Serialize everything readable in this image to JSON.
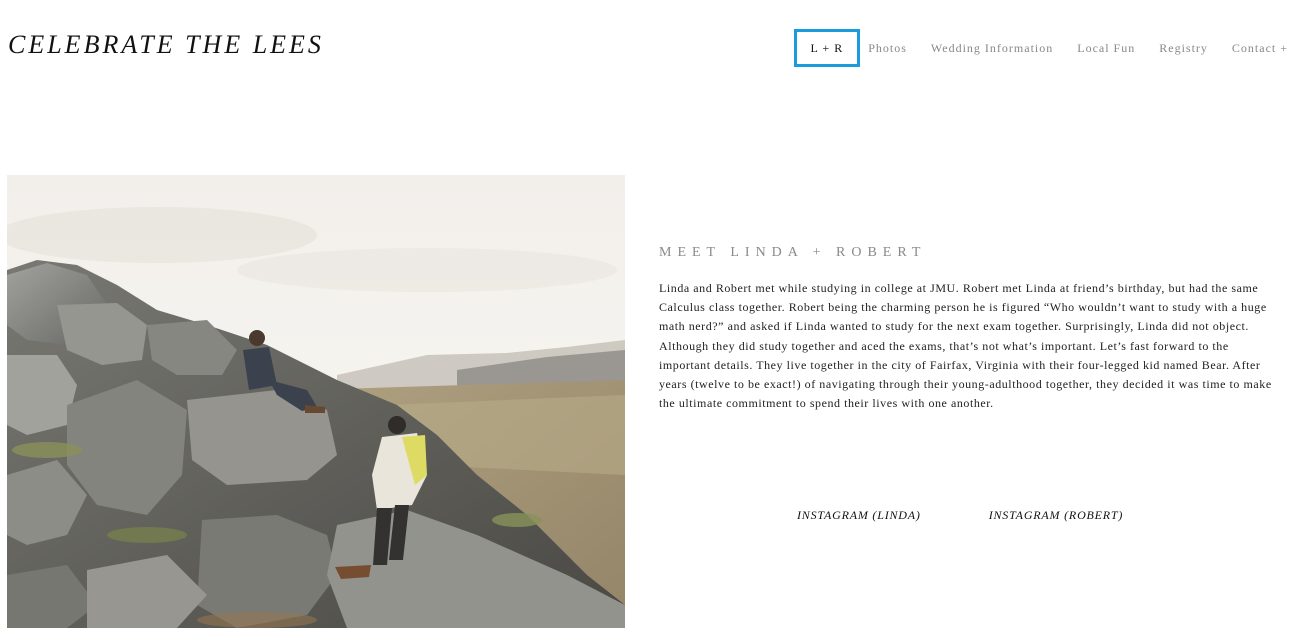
{
  "site": {
    "title": "CELEBRATE THE LEES"
  },
  "nav": {
    "items": [
      {
        "label": "L + R",
        "active": true
      },
      {
        "label": "Photos"
      },
      {
        "label": "Wedding Information"
      },
      {
        "label": "Local Fun"
      },
      {
        "label": "Registry"
      },
      {
        "label": "Contact +"
      }
    ]
  },
  "about": {
    "heading": "MEET LINDA + ROBERT",
    "body": "Linda and Robert met while studying in college at JMU. Robert met Linda at friend’s birthday, but had the same Calculus class together. Robert being the charming person he is figured “Who wouldn’t want to study with a huge math nerd?” and asked if Linda wanted to study for the next exam together. Surprisingly, Linda did not object. Although they did study together and aced the exams, that’s not what’s important. Let’s fast forward to the important details. They live together in the city of Fairfax, Virginia with their four-legged kid named Bear. After years (twelve to be exact!) of navigating through their young-adulthood together, they decided it was time to make the ultimate commitment to spend their lives with one another."
  },
  "social": {
    "links": [
      {
        "label": "INSTAGRAM (LINDA)"
      },
      {
        "label": "INSTAGRAM (ROBERT)"
      }
    ]
  },
  "colors": {
    "active_nav_border": "#1a9bdb",
    "nav_text": "#888888",
    "heading_text": "#8a8a8a"
  }
}
